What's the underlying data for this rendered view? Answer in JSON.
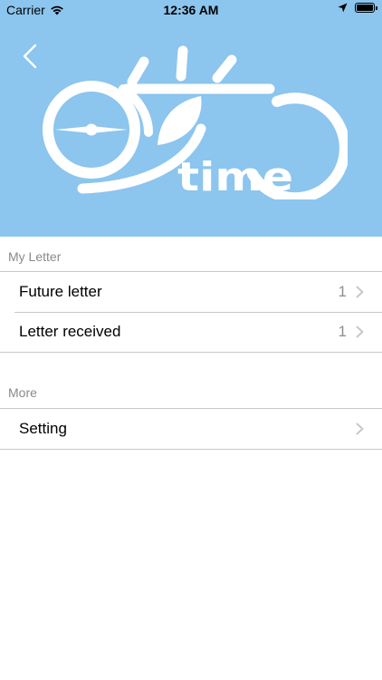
{
  "status_bar": {
    "carrier": "Carrier",
    "time": "12:36 AM"
  },
  "header": {
    "background_color": "#8cc5ee",
    "logo_text": "time"
  },
  "sections": [
    {
      "title": "My Letter",
      "rows": [
        {
          "label": "Future letter",
          "value": "1"
        },
        {
          "label": "Letter received",
          "value": "1"
        }
      ]
    },
    {
      "title": "More",
      "rows": [
        {
          "label": "Setting",
          "value": ""
        }
      ]
    }
  ],
  "icons": {
    "back": "chevron-left-icon",
    "disclosure": "chevron-right-icon",
    "wifi": "wifi-icon",
    "location": "location-arrow-icon",
    "battery": "battery-icon"
  }
}
